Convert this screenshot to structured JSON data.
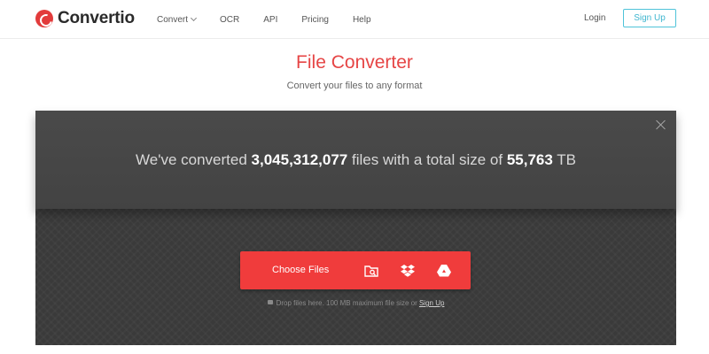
{
  "header": {
    "logo_text": "Convertio",
    "nav": [
      {
        "label": "Convert"
      },
      {
        "label": "OCR"
      },
      {
        "label": "API"
      },
      {
        "label": "Pricing"
      },
      {
        "label": "Help"
      }
    ],
    "login_label": "Login",
    "signup_label": "Sign Up"
  },
  "hero": {
    "title": "File Converter",
    "subtitle": "Convert your files to any format"
  },
  "stats": {
    "prefix": "We've converted",
    "files_count": "3,045,312,077",
    "middle": "files with a total size of",
    "total_size": "55,763",
    "unit": "TB"
  },
  "upload": {
    "choose_label": "Choose Files",
    "hint_text": "Drop files here. 100 MB maximum file size or",
    "hint_link": "Sign Up"
  },
  "colors": {
    "accent": "#f03c3c",
    "title": "#e64545",
    "signup_border": "#4fc3d9"
  },
  "icons": [
    "folder-search-icon",
    "dropbox-icon",
    "google-drive-icon",
    "close-icon",
    "lock-icon"
  ]
}
